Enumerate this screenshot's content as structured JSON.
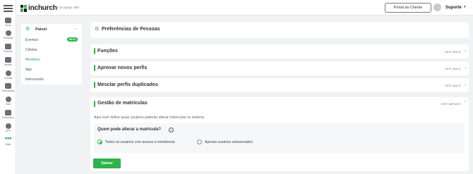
{
  "rail": [
    {
      "label": "Início",
      "icon": "home-icon"
    },
    {
      "label": "Pessoas",
      "icon": "people-icon"
    },
    {
      "label": "Eventos",
      "icon": "calendar-icon"
    },
    {
      "label": "Mídias",
      "icon": "media-icon"
    },
    {
      "label": "Células",
      "icon": "cells-icon"
    },
    {
      "label": "Intercessão",
      "icon": "prayer-icon"
    },
    {
      "label": "Fale",
      "icon": "chat-icon"
    },
    {
      "label": "Financeiro",
      "icon": "finance-icon"
    },
    {
      "label": "APP",
      "icon": "app-icon"
    },
    {
      "label": "Mais",
      "icon": "more-icon"
    }
  ],
  "header": {
    "brand": "inchurch",
    "church_id": "ID da igreja: 650",
    "portal_button": "Portal do Cliente",
    "user_name": "Suporte",
    "caret": "▾"
  },
  "sidebar": {
    "title": "Painel",
    "items": [
      {
        "label": "Eventos",
        "badge": "BETA",
        "active": false
      },
      {
        "label": "Células",
        "active": false
      },
      {
        "label": "Membros",
        "active": true
      },
      {
        "label": "App",
        "active": false
      },
      {
        "label": "Intercessão",
        "active": false
      }
    ]
  },
  "page": {
    "title": "Preferências de Pessoas"
  },
  "sections": [
    {
      "title": "Funções",
      "toggle": "VER MAIS"
    },
    {
      "title": "Aprovar novos perfis",
      "toggle": "VER MAIS"
    },
    {
      "title": "Mesclar perfis duplicados",
      "toggle": "VER MAIS"
    }
  ],
  "matriculas": {
    "title": "Gestão de matrículas",
    "toggle": "VER MENOS",
    "description": "Aqui você define quais usuários poderão alterar matrículas no sistema.",
    "question": "Quem pode alterar a matrícula?",
    "options": [
      {
        "label": "Todos os usuários com acesso a membresia",
        "selected": true
      },
      {
        "label": "Apenas usuários selecionados",
        "selected": false
      }
    ],
    "save_label": "Salvar"
  },
  "colors": {
    "accent": "#2eb34a",
    "background": "#f1f2f4"
  }
}
